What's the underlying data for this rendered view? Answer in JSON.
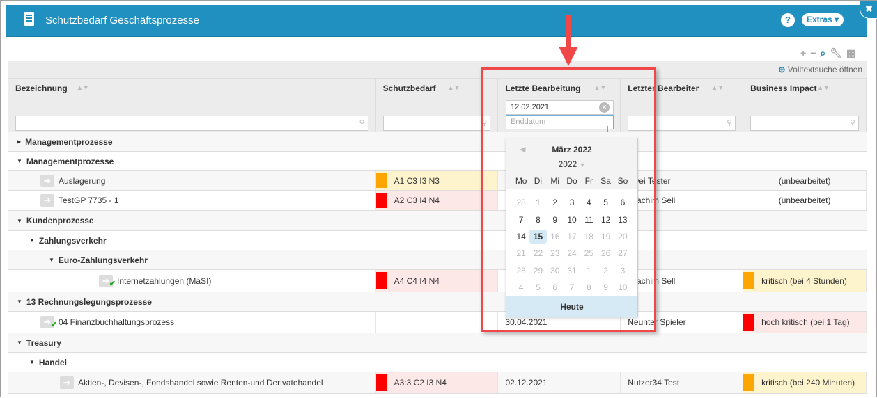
{
  "header": {
    "title": "Schutzbedarf Geschäftsprozesse",
    "help": "?",
    "extras": "Extras ▾",
    "close": "✖"
  },
  "toolbar": {
    "icons": [
      "plus-icon",
      "minus-icon",
      "search-icon",
      "wrench-icon",
      "calendar-icon"
    ]
  },
  "fulltext": "Volltextsuche öffnen",
  "columns": [
    {
      "label": "Bezeichnung",
      "filter": ""
    },
    {
      "label": "Schutzbedarf",
      "filter": ""
    },
    {
      "label": "Letzte Bearbeitung",
      "filter": "12.02.2021",
      "end_placeholder": "Enddatum"
    },
    {
      "label": "Letzter Bearbeiter",
      "filter": ""
    },
    {
      "label": "Business Impact",
      "filter": ""
    }
  ],
  "colors": {
    "orange": "#ffa500",
    "red": "#ff0000",
    "orange_bg": "#fdf3cc",
    "red_bg": "#fde8e8",
    "header": "#2090c0",
    "highlight": "#f04848"
  },
  "rows": [
    {
      "type": "group",
      "level": 0,
      "collapsed": true,
      "name": "Managementprozesse"
    },
    {
      "type": "group",
      "level": 0,
      "name": "Managementprozesse"
    },
    {
      "type": "item",
      "level": 1,
      "name": "Auslagerung",
      "schutz": "A1 C3 I3 N3",
      "schutz_sev": "orange",
      "date": "",
      "user": "Zwei Tester",
      "impact": "(unbearbeitet)",
      "impact_sev": ""
    },
    {
      "type": "item",
      "level": 1,
      "name": "TestGP 7735 - 1",
      "schutz": "A2 C3 I4 N4",
      "schutz_sev": "red",
      "date": "",
      "user": "Joachim Sell",
      "impact": "(unbearbeitet)",
      "impact_sev": ""
    },
    {
      "type": "group",
      "level": 0,
      "name": "Kundenprozesse"
    },
    {
      "type": "group",
      "level": 1,
      "name": "Zahlungsverkehr"
    },
    {
      "type": "group",
      "level": 2,
      "name": "Euro-Zahlungsverkehr"
    },
    {
      "type": "item",
      "level": 3,
      "name": "Internetzahlungen (MaSI)",
      "check": true,
      "schutz": "A4 C4 I4 N4",
      "schutz_sev": "red",
      "date": "",
      "user": "Joachim Sell",
      "impact": "kritisch (bei 4 Stunden)",
      "impact_sev": "orange"
    },
    {
      "type": "group",
      "level": 0,
      "name": "13 Rechnungslegungsprozesse"
    },
    {
      "type": "item",
      "level": 1,
      "name": "04 Finanzbuchhaltungsprozess",
      "check": true,
      "schutz": "",
      "schutz_sev": "",
      "date": "30.04.2021",
      "user": "Neunter Spieler",
      "impact": "hoch kritisch (bei 1 Tag)",
      "impact_sev": "red"
    },
    {
      "type": "group",
      "level": 0,
      "name": "Treasury"
    },
    {
      "type": "group",
      "level": 1,
      "name": "Handel"
    },
    {
      "type": "item",
      "level": 2,
      "name": "Aktien-, Devisen-, Fondshandel sowie Renten-und Derivatehandel",
      "schutz": "A3:3 C2 I3 N4",
      "schutz_sev": "red",
      "date": "02.12.2021",
      "user": "Nutzer34 Test",
      "impact": "kritisch (bei 240 Minuten)",
      "impact_sev": "orange"
    }
  ],
  "calendar": {
    "month": "März 2022",
    "year": "2022",
    "weekdays": [
      "Mo",
      "Di",
      "Mi",
      "Do",
      "Fr",
      "Sa",
      "So"
    ],
    "weeks": [
      [
        "28",
        "1",
        "2",
        "3",
        "4",
        "5",
        "6"
      ],
      [
        "7",
        "8",
        "9",
        "10",
        "11",
        "12",
        "13"
      ],
      [
        "14",
        "15",
        "16",
        "17",
        "18",
        "19",
        "20"
      ],
      [
        "21",
        "22",
        "23",
        "24",
        "25",
        "26",
        "27"
      ],
      [
        "28",
        "29",
        "30",
        "31",
        "1",
        "2",
        "3"
      ],
      [
        "4",
        "5",
        "6",
        "7",
        "8",
        "9",
        "10"
      ]
    ],
    "today": "15",
    "today_label": "Heute"
  }
}
